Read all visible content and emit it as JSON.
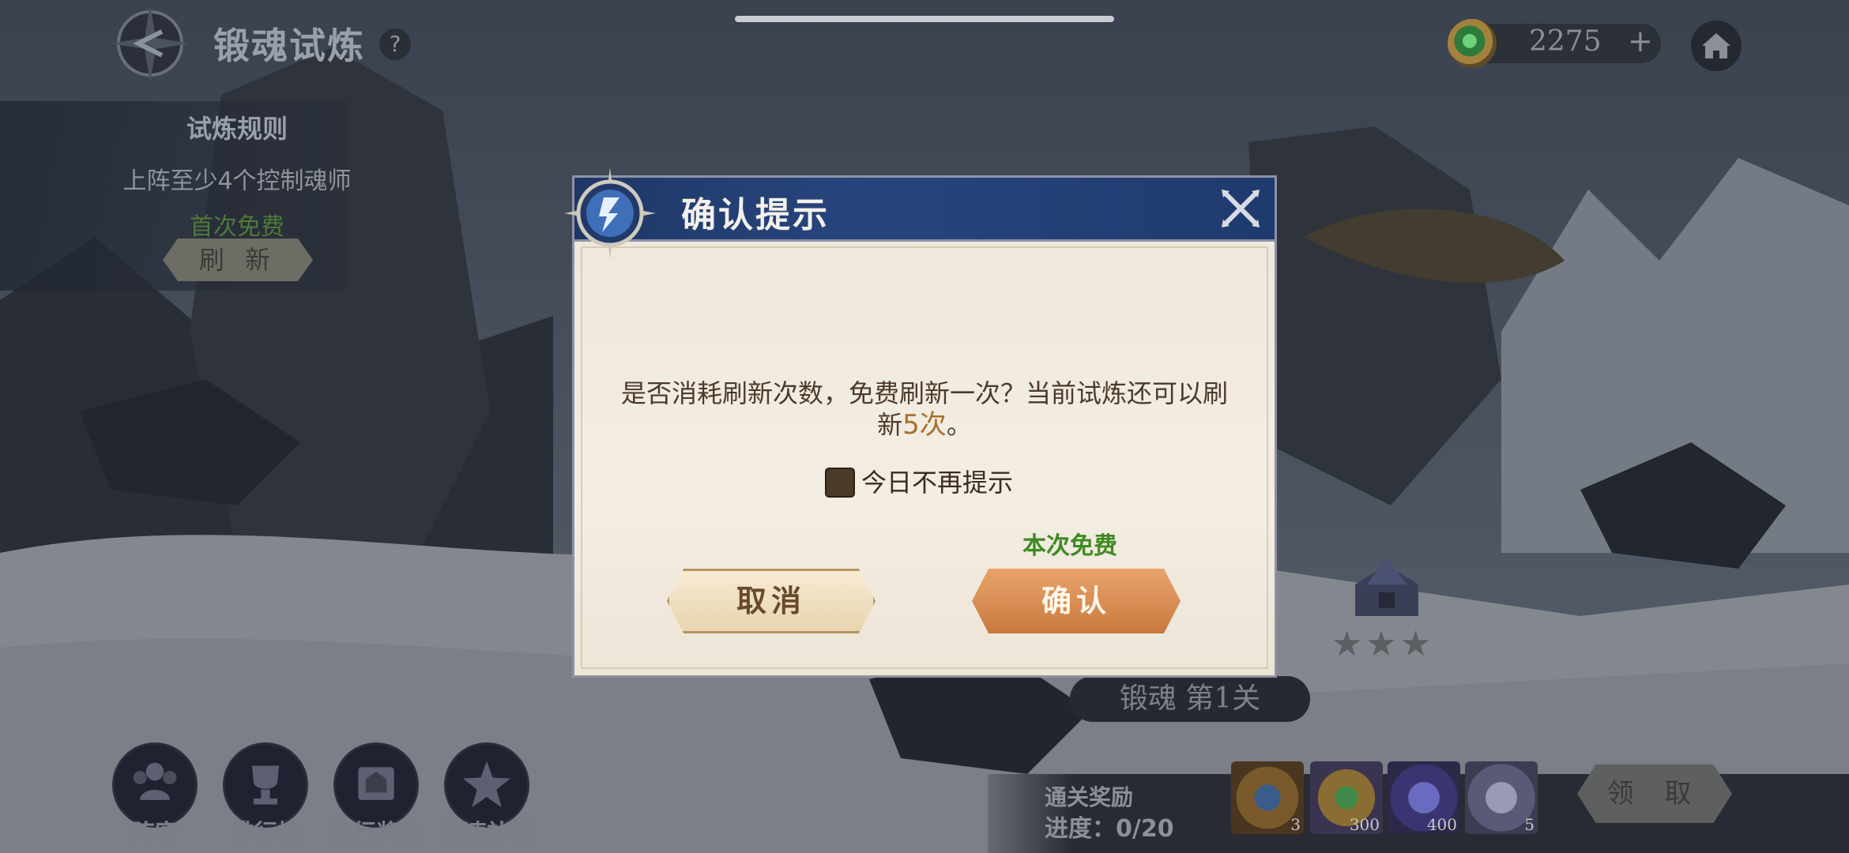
{
  "header": {
    "page_title": "锻魂试炼",
    "help_label": "?",
    "currency": {
      "icon": "green-orb-icon",
      "value": "2275",
      "add_label": "+"
    },
    "home_icon": "home-icon"
  },
  "rules": {
    "title": "试炼规则",
    "requirement": "上阵至少4个控制魂师",
    "first_free": "首次免费",
    "refresh_label": "刷 新"
  },
  "stage": {
    "stars": "★★★",
    "label": "锻魂  第1关"
  },
  "bottom_menu": [
    {
      "label": "阵容",
      "icon": "team-icon"
    },
    {
      "label": "排行榜",
      "icon": "trophy-icon"
    },
    {
      "label": "排行奖励",
      "icon": "ranking-reward-icon"
    },
    {
      "label": "快速补星",
      "icon": "star-icon"
    }
  ],
  "rewards": {
    "title": "通关奖励",
    "progress": "进度：0/20",
    "items": [
      {
        "icon": "soul-ring-icon",
        "qty": "3"
      },
      {
        "icon": "green-orb-icon",
        "qty": "300"
      },
      {
        "icon": "crystal-icon",
        "qty": "400"
      },
      {
        "icon": "soul-shard-icon",
        "qty": "5"
      }
    ],
    "claim_label": "领 取"
  },
  "dialog": {
    "title": "确认提示",
    "message_part1": "是否消耗刷新次数，免费刷新一次？当前试炼还可以刷",
    "message_part2": "新",
    "message_highlight": "5次",
    "message_end": "。",
    "checkbox_label": "今日不再提示",
    "free_note": "本次免费",
    "cancel_label": "取消",
    "confirm_label": "确认"
  },
  "colors": {
    "dialog_header": "#27457d",
    "dialog_body": "#f3ede3",
    "confirm_button": "#d88d55",
    "free_text": "#3f8a23",
    "highlight": "#a8702c"
  }
}
